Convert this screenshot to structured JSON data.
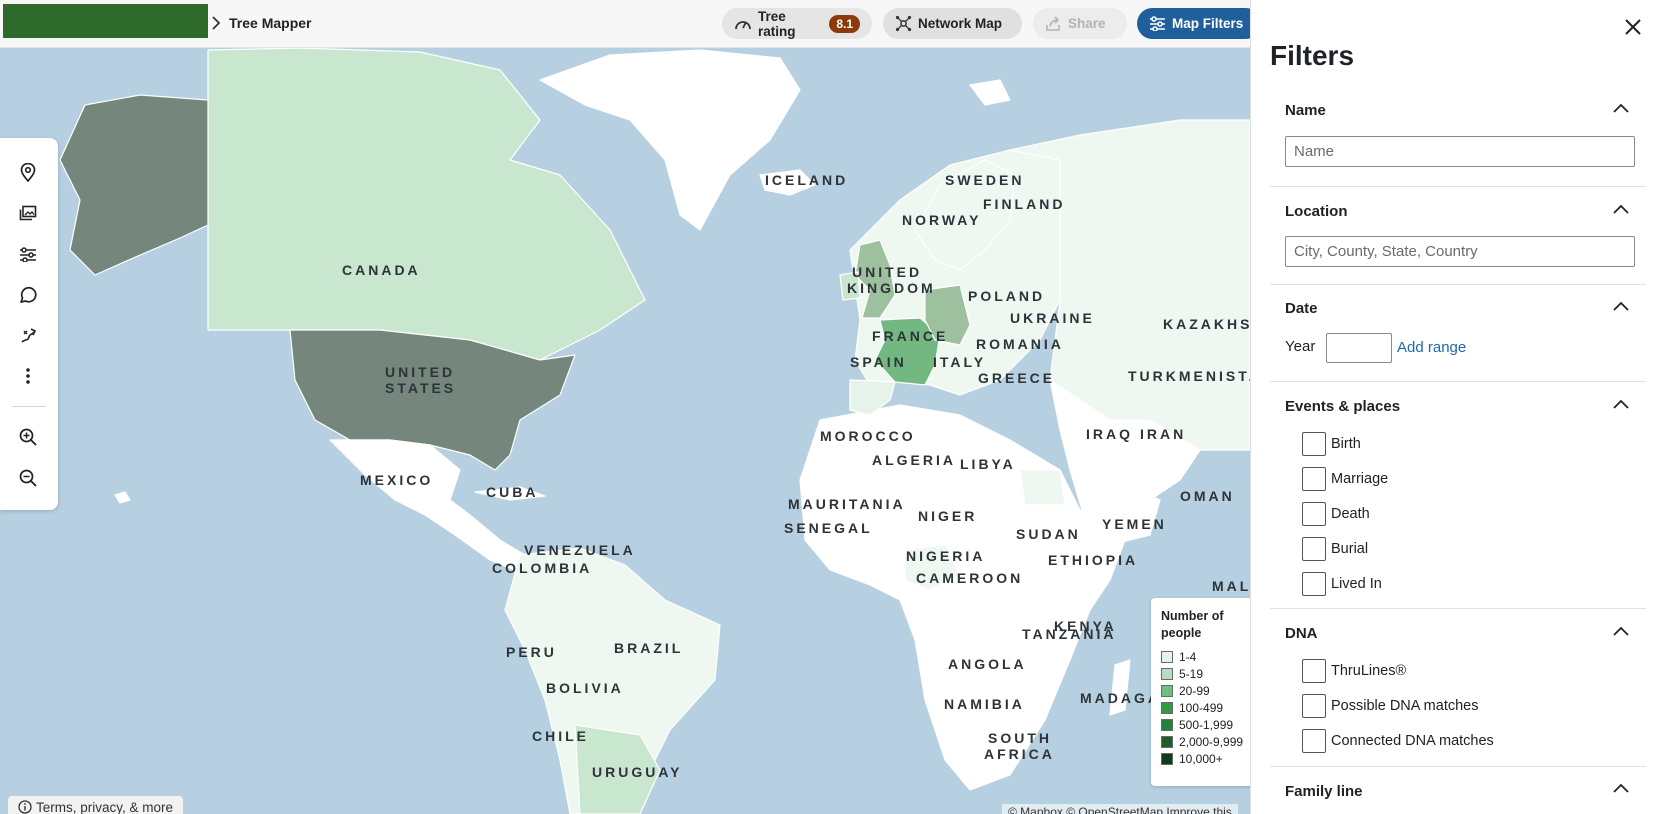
{
  "header": {
    "breadcrumb_title": "Tree Mapper",
    "tree_rating_label": "Tree rating",
    "tree_rating_value": "8.1",
    "network_map_label": "Network Map",
    "share_label": "Share",
    "map_filters_label": "Map Filters"
  },
  "map": {
    "places": {
      "iceland": "ICELAND",
      "sweden": "SWEDEN",
      "finland": "FINLAND",
      "norway": "NORWAY",
      "canada": "CANADA",
      "united": "UNITED",
      "kingdom": "KINGDOM",
      "poland": "POLAND",
      "ukraine": "UKRAINE",
      "kazakhs": "KAZAKHS",
      "france": "FRANCE",
      "romania": "ROMANIA",
      "united_states_1": "UNITED",
      "united_states_2": "STATES",
      "spain": "SPAIN",
      "italy": "ITALY",
      "greece": "GREECE",
      "turkmenistan": "TURKMENISTA",
      "morocco": "MOROCCO",
      "iraq": "IRAQ",
      "iran": "IRAN",
      "algeria": "ALGERIA",
      "libya": "LIBYA",
      "mexico": "MEXICO",
      "cuba": "CUBA",
      "oman": "OMAN",
      "mauritania": "MAURITANIA",
      "niger": "NIGER",
      "senegal": "SENEGAL",
      "sudan": "SUDAN",
      "yemen": "YEMEN",
      "venezuela": "VENEZUELA",
      "nigeria": "NIGERIA",
      "ethiopia": "ETHIOPIA",
      "cameroon": "CAMEROON",
      "colombia": "COLOMBIA",
      "mali": "MALI",
      "kenya": "KENYA",
      "brazil": "BRAZIL",
      "peru": "PERU",
      "tanzania": "TANZANIA",
      "bolivia": "BOLIVIA",
      "angola": "ANGOLA",
      "namibia": "NAMIBIA",
      "madagascar": "MADAGAS",
      "chile": "CHILE",
      "south": "SOUTH",
      "africa": "AFRICA",
      "uruguay": "URUGUAY"
    },
    "toolbar_icons": [
      "location-pin-icon",
      "photos-icon",
      "sliders-icon",
      "speech-bubble-icon",
      "route-icon",
      "more-vertical-icon",
      "zoom-in-icon",
      "zoom-out-icon"
    ],
    "terms_label": "Terms, privacy, & more",
    "attribution": "© Mapbox © OpenStreetMap Improve this"
  },
  "legend": {
    "title": "Number of people",
    "items": [
      {
        "label": "1-4",
        "color": "#e6f3ea"
      },
      {
        "label": "5-19",
        "color": "#b8dcc0"
      },
      {
        "label": "20-99",
        "color": "#6fbf7e"
      },
      {
        "label": "100-499",
        "color": "#2f9a43"
      },
      {
        "label": "500-1,999",
        "color": "#24803a"
      },
      {
        "label": "2,000-9,999",
        "color": "#1c5e2c"
      },
      {
        "label": "10,000+",
        "color": "#0f3a1b"
      }
    ]
  },
  "filters": {
    "title": "Filters",
    "name": {
      "heading": "Name",
      "placeholder": "Name"
    },
    "location": {
      "heading": "Location",
      "placeholder": "City, County, State, Country"
    },
    "date": {
      "heading": "Date",
      "year_label": "Year",
      "add_range_label": "Add range"
    },
    "events": {
      "heading": "Events & places",
      "options": [
        "Birth",
        "Marriage",
        "Death",
        "Burial",
        "Lived In"
      ]
    },
    "dna": {
      "heading": "DNA",
      "options": [
        "ThruLines®",
        "Possible DNA matches",
        "Connected DNA matches"
      ]
    },
    "family_line": {
      "heading": "Family line"
    }
  }
}
